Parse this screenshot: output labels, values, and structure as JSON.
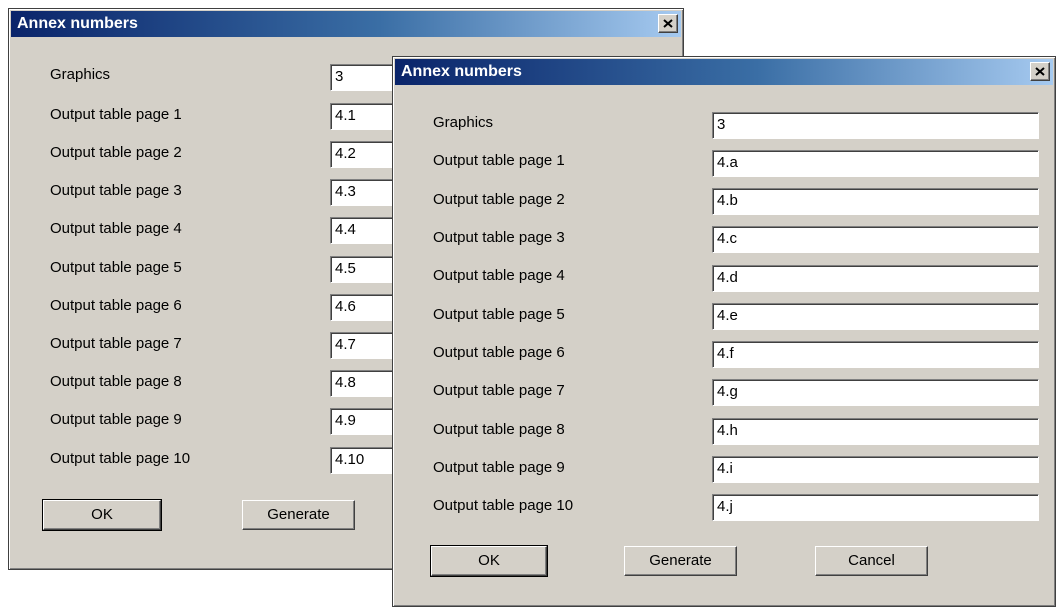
{
  "dialog_back": {
    "title": "Annex numbers",
    "labels": [
      "Graphics",
      "Output table page  1",
      "Output table page  2",
      "Output table page  3",
      "Output table page  4",
      "Output table page  5",
      "Output table page  6",
      "Output table page  7",
      "Output table page  8",
      "Output table page  9",
      "Output table page 10"
    ],
    "values": [
      "3",
      "4.1",
      "4.2",
      "4.3",
      "4.4",
      "4.5",
      "4.6",
      "4.7",
      "4.8",
      "4.9",
      "4.10"
    ],
    "ok_label": "OK",
    "generate_label": "Generate"
  },
  "dialog_front": {
    "title": "Annex numbers",
    "labels": [
      "Graphics",
      "Output table page  1",
      "Output table page  2",
      "Output table page  3",
      "Output table page  4",
      "Output table page  5",
      "Output table page  6",
      "Output table page  7",
      "Output table page  8",
      "Output table page  9",
      "Output table page 10"
    ],
    "values": [
      "3",
      "4.a",
      "4.b",
      "4.c",
      "4.d",
      "4.e",
      "4.f",
      "4.g",
      "4.h",
      "4.i",
      "4.j"
    ],
    "ok_label": "OK",
    "generate_label": "Generate",
    "cancel_label": "Cancel"
  },
  "icons": {
    "close": "close-icon"
  }
}
